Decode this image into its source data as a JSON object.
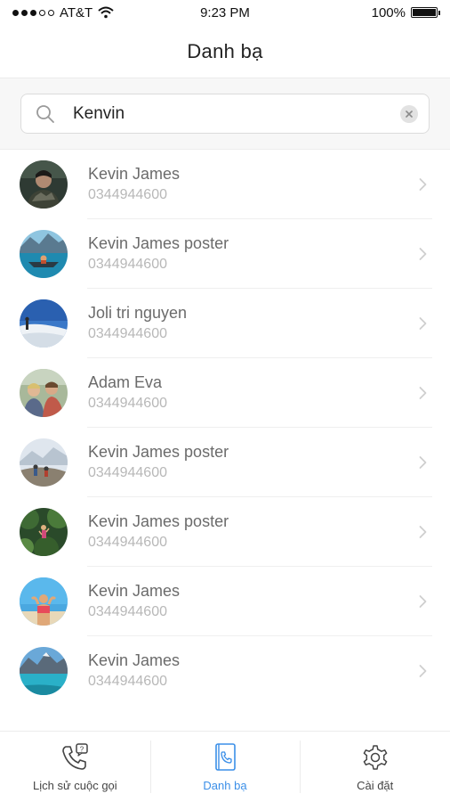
{
  "status_bar": {
    "carrier": "AT&T",
    "time": "9:23 PM",
    "battery": "100%",
    "battery_level": 1.0,
    "signal_bars": 2
  },
  "header": {
    "title": "Danh bạ"
  },
  "search": {
    "value": "Kenvin",
    "placeholder": ""
  },
  "contacts": [
    {
      "name": "Kevin James",
      "phone": "0344944600",
      "avatar": "person-portrait"
    },
    {
      "name": "Kevin James poster",
      "phone": "0344944600",
      "avatar": "lake-canoe"
    },
    {
      "name": "Joli tri nguyen",
      "phone": "0344944600",
      "avatar": "snow-mountain"
    },
    {
      "name": "Adam Eva",
      "phone": "0344944600",
      "avatar": "group-selfie"
    },
    {
      "name": "Kevin James poster",
      "phone": "0344944600",
      "avatar": "mountain-hikers"
    },
    {
      "name": "Kevin James poster",
      "phone": "0344944600",
      "avatar": "forest-climber"
    },
    {
      "name": "Kevin James",
      "phone": "0344944600",
      "avatar": "beach-sky"
    },
    {
      "name": "Kevin James",
      "phone": "0344944600",
      "avatar": "mountain-lake"
    }
  ],
  "tab_bar": {
    "tabs": [
      {
        "label": "Lịch sử cuộc gọi",
        "icon": "call-history-icon",
        "active": false
      },
      {
        "label": "Danh bạ",
        "icon": "contacts-book-icon",
        "active": true
      },
      {
        "label": "Cài đặt",
        "icon": "gear-icon",
        "active": false
      }
    ]
  },
  "colors": {
    "accent": "#3b8fe8",
    "name_text": "#6b6b6b",
    "phone_text": "#b8b8b8",
    "separator": "#efefef"
  }
}
